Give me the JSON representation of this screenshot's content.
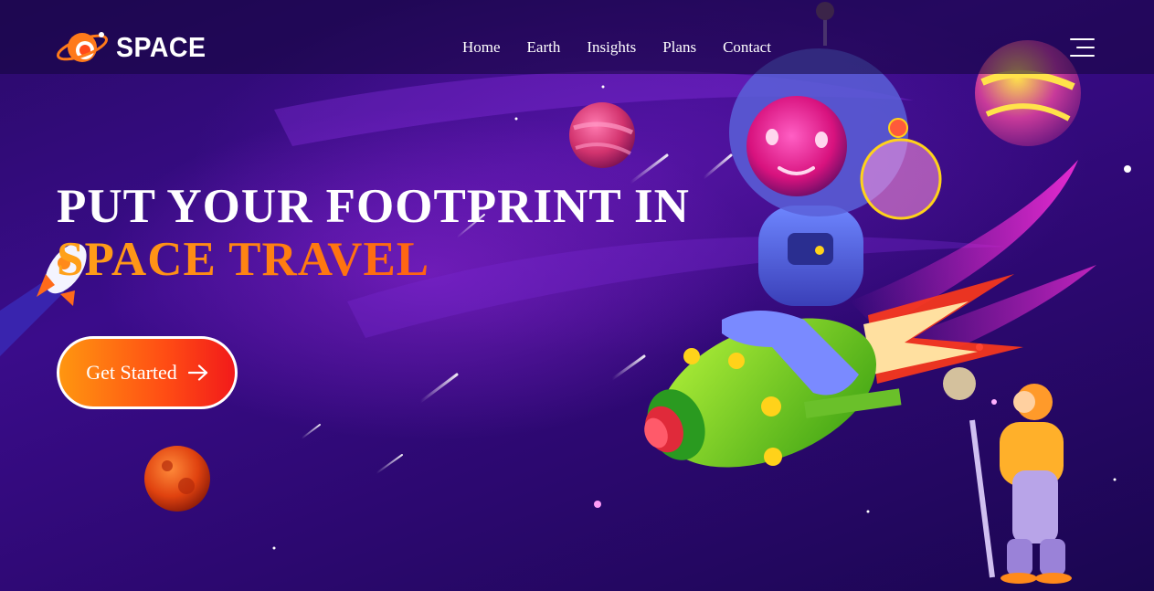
{
  "brand": {
    "name": "SPACE",
    "icon": "planet-logo-icon"
  },
  "nav": {
    "links": [
      "Home",
      "Earth",
      "Insights",
      "Plans",
      "Contact"
    ],
    "menu_icon": "hamburger-menu-icon"
  },
  "hero": {
    "line1": "PUT YOUR FOOTPRINT IN",
    "line2": "SPACE TRAVEL",
    "cta_label": "Get Started",
    "cta_icon": "arrow-right-icon"
  },
  "colors": {
    "background": "#2c0870",
    "accent_orange": "#ff8a12",
    "accent_red": "#ff2b16",
    "nav_bg": "#14063c"
  }
}
